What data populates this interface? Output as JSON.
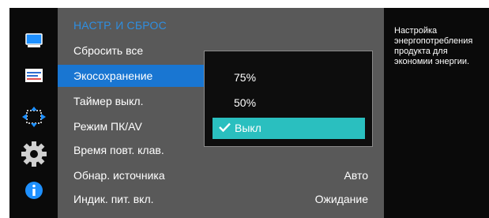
{
  "sidebar": {
    "icons": [
      "monitor-icon",
      "display-settings-icon",
      "resize-icon",
      "gear-icon",
      "info-icon"
    ]
  },
  "menu": {
    "title": "НАСТР. И СБРОС",
    "items": [
      {
        "label": "Сбросить все",
        "value": ""
      },
      {
        "label": "Экосохранение",
        "value": ""
      },
      {
        "label": "Таймер выкл.",
        "value": ""
      },
      {
        "label": "Режим ПК/AV",
        "value": ""
      },
      {
        "label": "Время повт. клав.",
        "value": ""
      },
      {
        "label": "Обнар. источника",
        "value": "Авто"
      },
      {
        "label": "Индик. пит. вкл.",
        "value": "Ожидание"
      }
    ]
  },
  "popup": {
    "options": [
      {
        "label": "75%"
      },
      {
        "label": "50%"
      },
      {
        "label": "Выкл"
      }
    ]
  },
  "help": {
    "text": "Настройка энергопотребления продукта для экономии энергии."
  },
  "colors": {
    "selected_item": "#1976d2",
    "selected_option": "#2abfbf",
    "title": "#2f8ee0"
  }
}
